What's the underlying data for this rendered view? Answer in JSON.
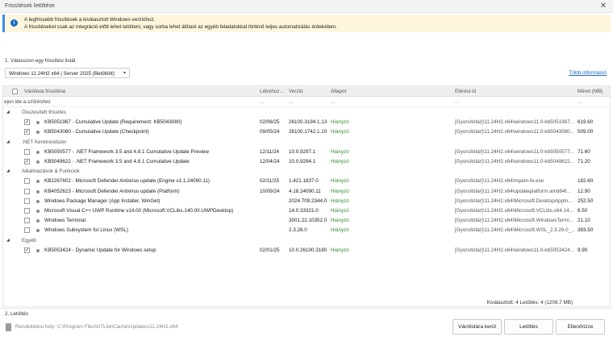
{
  "window": {
    "title": "Frissítések letöltése",
    "close_icon": "close-icon"
  },
  "info": {
    "icon": "info-icon",
    "line1": "A legfrissebb frissítések a kiválasztott Windows-verzióhoz.",
    "line2": "A frissítéseket csak az integráció előtt lehet letölteni, vagy sorba lehet állítani az egyéb feladatokkal történő teljes automatizálás érdekében."
  },
  "section1": {
    "label": "1. Válasszon egy frissítési listát"
  },
  "update_list": {
    "selected": "Windows 11 24H2 x64 | Server 2025 (Betöltött)"
  },
  "more_info": "Több információ",
  "grid": {
    "columns": {
      "name": "Várólista frissítése",
      "date": "Létrehoz...",
      "version": "Verzió",
      "status": "Állapot",
      "path": "Elérési út",
      "size": "Méret (MB)"
    },
    "filter_placeholder": "ejon ide a szűréshez",
    "filter_dots": "..."
  },
  "groups": [
    {
      "name": "Összesített frissítés",
      "items": [
        {
          "checked": true,
          "name": "KB5051987 - Cumulative Update (Requirement: KB5043080)",
          "date": "02/08/25",
          "version": "26100.3194.1.13",
          "status": "Hiányzó",
          "path": "[Gyorsítótár]\\11.24H2.x64\\windows11.0-kb5051987...",
          "size": "619.60"
        },
        {
          "checked": true,
          "name": "KB5043080 - Cumulative Update (Checkpoint)",
          "date": "09/05/24",
          "version": "26100.1742.1.10",
          "status": "Hiányzó",
          "path": "[Gyorsítótár]\\11.24H2.x64\\windows11.0-kb5043080...",
          "size": "509.00"
        }
      ]
    },
    {
      "name": ".NET Keretrendszer",
      "items": [
        {
          "checked": false,
          "name": "KB5050577 - .NET Framework 3.5 and 4.8.1 Cumulative Update Preview",
          "date": "12/11/24",
          "version": "10.0.9297.1",
          "status": "Hiányzó",
          "path": "[Gyorsítótár]\\11.24H2.x64\\windows11.0-kb5050577...",
          "size": "71.60"
        },
        {
          "checked": true,
          "name": "KB5049622 - .NET Framework 3.5 and 4.8.1 Cumulative Update",
          "date": "12/04/24",
          "version": "10.0.9294.1",
          "status": "Hiányzó",
          "path": "[Gyorsítótár]\\11.24H2.x64\\windows11.0-kb5049622...",
          "size": "71.20"
        }
      ]
    },
    {
      "name": "Alkalmazások & Funkciók",
      "items": [
        {
          "checked": false,
          "name": "KB2267602 - Microsoft Defender Antivirus update (Engine v1.1.24090.11)",
          "date": "02/11/25",
          "version": "1.421.1837.0",
          "status": "Hiányzó",
          "path": "[Gyorsítótár]\\11.24H2.x64\\mpam-fe.exe",
          "size": "182.60"
        },
        {
          "checked": false,
          "name": "KB4052623 - Microsoft Defender Antivirus update (Platform)",
          "date": "10/09/24",
          "version": "4.18.24090.11",
          "status": "Hiányzó",
          "path": "[Gyorsítótár]\\11.24H2.x64\\updateplatform.amd64f...",
          "size": "12.90"
        },
        {
          "checked": false,
          "name": "Windows Package Manager (App Installer, WinGet)",
          "date": "",
          "version": "2024.709.2344.0",
          "status": "Hiányzó",
          "path": "[Gyorsítótár]\\11.24H2.x64\\Microsoft.DesktopAppIn...",
          "size": "252.50"
        },
        {
          "checked": false,
          "name": "Microsoft Visual C++ UWP Runtime v14.00 (Microsoft.VCLibs.140.00.UWPDesktop)",
          "date": "",
          "version": "14.0.33321.0",
          "status": "Hiányzó",
          "path": "[Gyorsítótár]\\11.24H2.x64\\Microsoft.VCLibs.x64.14...",
          "size": "6.50"
        },
        {
          "checked": false,
          "name": "Windows Terminal",
          "date": "",
          "version": "3001.22.10352.0",
          "status": "Hiányzó",
          "path": "[Gyorsítótár]\\11.24H2.x64\\Microsoft.WindowsTermi...",
          "size": "21.10"
        },
        {
          "checked": false,
          "name": "Windows Subsystem for Linux (WSL)",
          "date": "",
          "version": "2.3.26.0",
          "status": "Hiányzó",
          "path": "[Gyorsítótár]\\11.24H2.x64\\Microsoft.WSL_2.3.26.0_...",
          "size": "383.50"
        }
      ]
    },
    {
      "name": "Egyéb",
      "items": [
        {
          "checked": true,
          "name": "KB5053424 - Dynamic Update for Windows setup",
          "date": "02/01/25",
          "version": "10.0.26100.3180",
          "status": "Hiányzó",
          "path": "[Gyorsítótár]\\11.24H2.x64\\windows11.0-kb5053424...",
          "size": "9.90"
        }
      ]
    }
  ],
  "summary": "Kiválasztott: 4 Letöltés: 4 (1209.7 MB)",
  "section2": {
    "label": "2. Letöltés"
  },
  "download_location": "Rendeltetési hely: C:\\Program Files\\NTLite\\Cache\\Updates\\11.24H2.x64",
  "buttons": {
    "clear_queue": "Várólistára kerül",
    "download": "Letöltés",
    "check": "Ellenőrizze"
  }
}
